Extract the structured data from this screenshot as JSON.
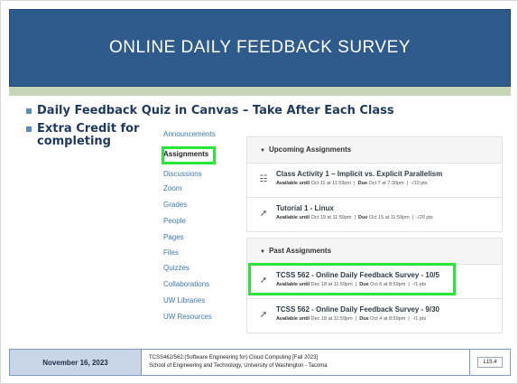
{
  "title": "ONLINE DAILY FEEDBACK SURVEY",
  "bullets": {
    "first": "Daily Feedback Quiz in Canvas – Take After Each Class",
    "second": "Extra Credit for completing"
  },
  "nav": {
    "items": [
      {
        "label": "Announcements",
        "active": false
      },
      {
        "label": "Assignments",
        "active": true
      },
      {
        "label": "Discussions",
        "active": false
      },
      {
        "label": "Zoom",
        "active": false
      },
      {
        "label": "Grades",
        "active": false
      },
      {
        "label": "People",
        "active": false
      },
      {
        "label": "Pages",
        "active": false
      },
      {
        "label": "Files",
        "active": false
      },
      {
        "label": "Quizzes",
        "active": false
      },
      {
        "label": "Collaborations",
        "active": false
      },
      {
        "label": "UW Libraries",
        "active": false
      },
      {
        "label": "UW Resources",
        "active": false
      }
    ]
  },
  "upcoming": {
    "header": "Upcoming Assignments",
    "items": [
      {
        "icon": "assignment-icon",
        "name": "Class Activity 1 – Implicit vs. Explicit Parallelism",
        "available": "Available until",
        "available_value": "Oct 11 at 11:59pm",
        "due": "Due",
        "due_value": "Oct 7 at 7:30pm",
        "points": "-/10 pts"
      },
      {
        "icon": "rocket-icon",
        "name": "Tutorial 1 - Linux",
        "available": "Available until",
        "available_value": "Oct 19 at 11:59pm",
        "due": "Due",
        "due_value": "Oct 15 at 11:59pm",
        "points": "-/20 pts"
      }
    ]
  },
  "past": {
    "header": "Past Assignments",
    "items": [
      {
        "icon": "rocket-icon",
        "name": "TCSS 562 - Online Daily Feedback Survey - 10/5",
        "available": "Available until",
        "available_value": "Dec 18 at 11:59pm",
        "due": "Due",
        "due_value": "Oct 6 at 8:59pm",
        "points": "-/1 pts"
      },
      {
        "icon": "rocket-icon",
        "name": "TCSS 562 - Online Daily Feedback Survey - 9/30",
        "available": "Available until",
        "available_value": "Dec 18 at 11:59pm",
        "due": "Due",
        "due_value": "Oct 4 at 8:59pm",
        "points": "-/1 pts"
      }
    ]
  },
  "footer": {
    "date": "November 16, 2023",
    "course_line1": "TCSS462/562:(Software Engineering for) Cloud Computing [Fall 2023]",
    "course_line2": "School of Engineering and Technology, University of Washington - Tacoma",
    "page": "L15.4"
  },
  "colors": {
    "title_bar": "#2f5a8c",
    "highlight": "#2ae43a",
    "link": "#3b78b5",
    "bullet_text": "#1f3a5f"
  }
}
